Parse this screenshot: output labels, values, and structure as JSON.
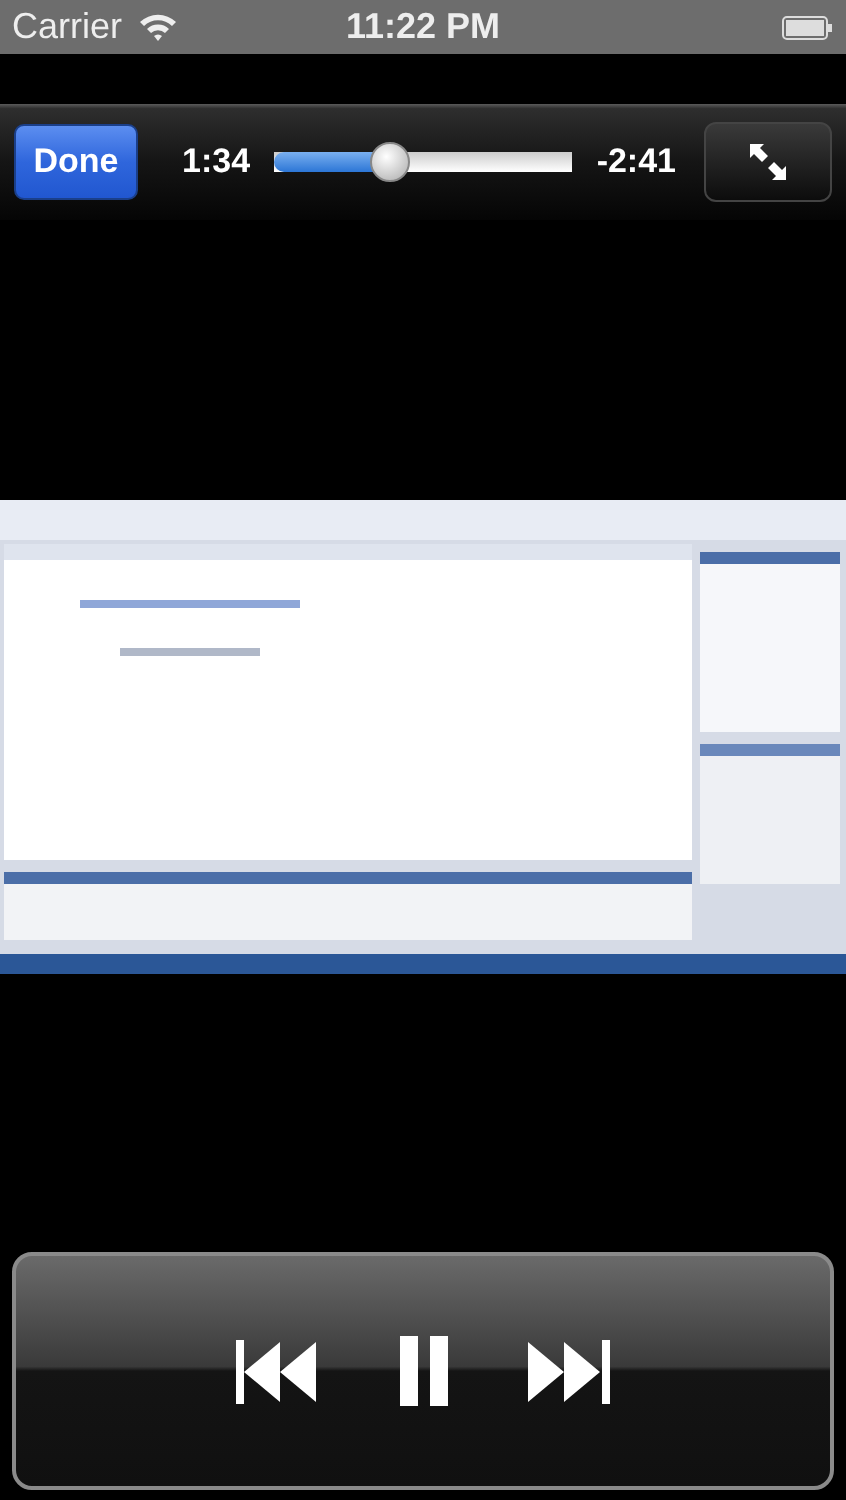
{
  "status_bar": {
    "carrier": "Carrier",
    "time": "11:22 PM"
  },
  "player_bar": {
    "done_label": "Done",
    "elapsed": "1:34",
    "remaining": "-2:41",
    "scrubber": {
      "level": 0.37
    }
  },
  "controls": {
    "playing": true
  }
}
